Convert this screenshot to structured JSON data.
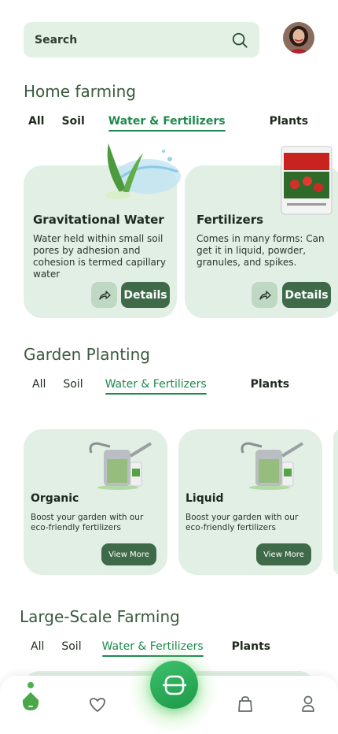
{
  "search": {
    "placeholder": "Search"
  },
  "sections": [
    {
      "title": "Home farming",
      "tabs": [
        "All",
        "Soil",
        "Water & Fertilizers",
        "Plants"
      ],
      "active_tab": "Water & Fertilizers",
      "cards": [
        {
          "title": "Gravitational  Water",
          "description": " Water held within small soil pores by adhesion and cohesion is termed capillary water",
          "button": "Details",
          "image": "aloe-water-splash"
        },
        {
          "title": "Fertilizers",
          "description": "Comes in many forms: Can get it in liquid, powder, granules, and spikes.",
          "button": "Details",
          "image": "fertilizer-bag"
        }
      ]
    },
    {
      "title": "Garden Planting",
      "tabs": [
        "All",
        "Soil",
        "Water & Fertilizers",
        "Plants"
      ],
      "active_tab": "Water & Fertilizers",
      "cards": [
        {
          "title": "Organic",
          "description": "Boost your garden with our eco-friendly fertilizers",
          "button": "View More",
          "image": "watering-can"
        },
        {
          "title": "Liquid",
          "description": "Boost your garden with our eco-friendly fertilizers",
          "button": "View More",
          "image": "watering-can"
        }
      ]
    },
    {
      "title": "Large-Scale Farming",
      "tabs": [
        "All",
        "Soil",
        "Water & Fertilizers",
        "Plants"
      ],
      "active_tab": "Water & Fertilizers"
    }
  ],
  "nav": {
    "items": [
      "home-icon",
      "heart-icon",
      "scan-icon",
      "bag-icon",
      "profile-icon"
    ],
    "active": "home-icon"
  },
  "colors": {
    "accent": "#1e8a4e",
    "card_bg": "#e1efe4",
    "button_bg": "#3f6a4a"
  }
}
